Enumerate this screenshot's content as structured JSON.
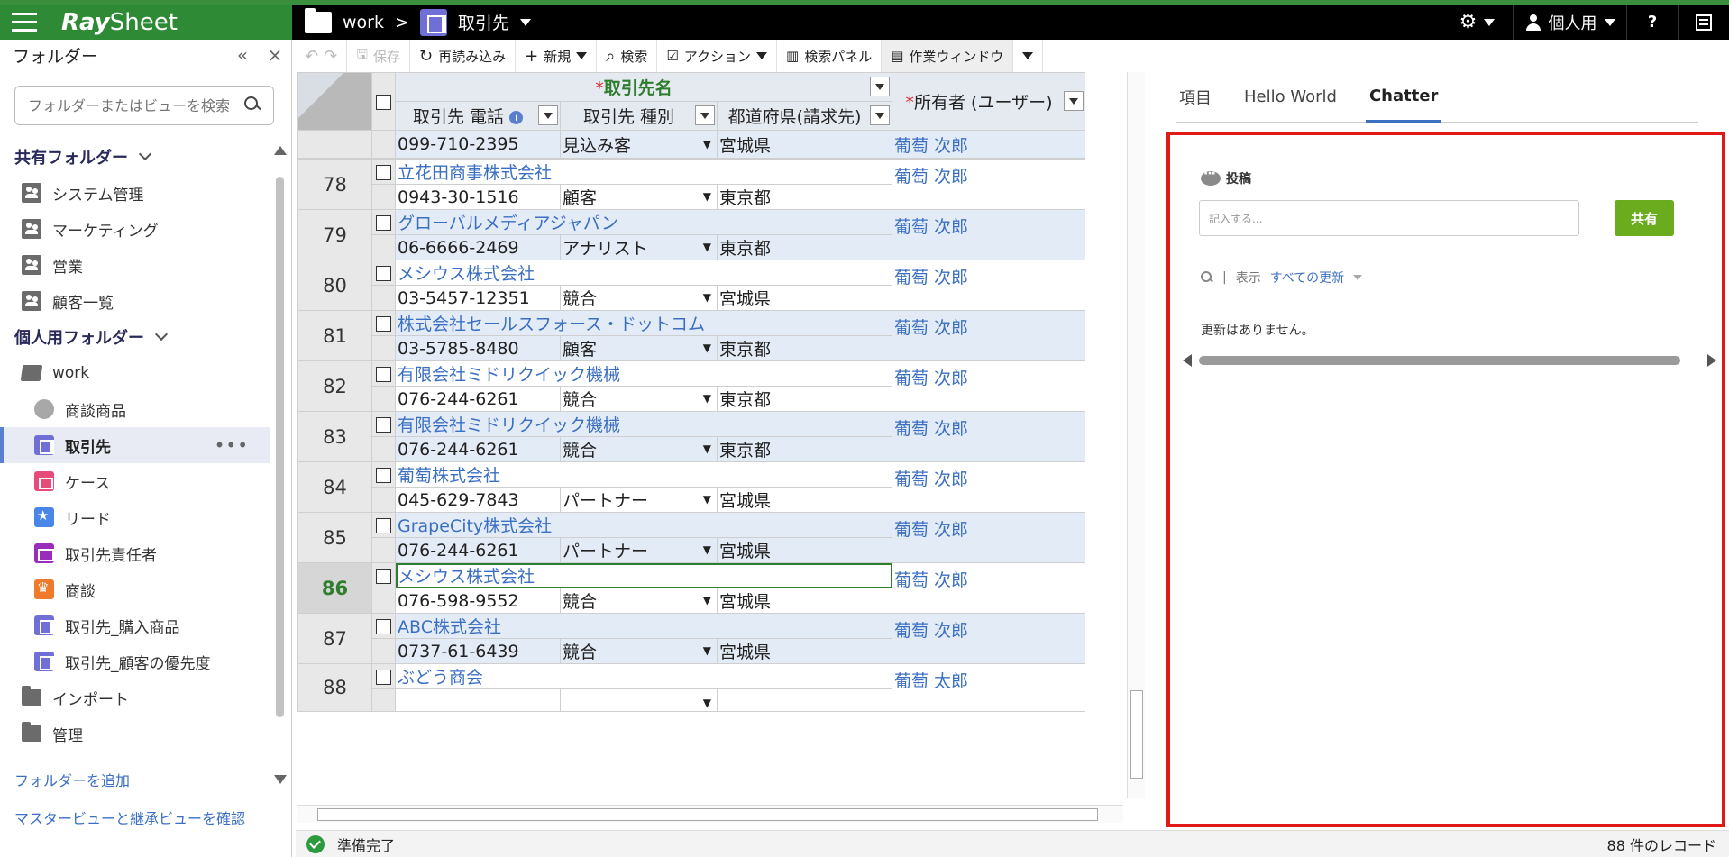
{
  "app": {
    "logo_bold": "Ray",
    "logo_rest": "Sheet"
  },
  "header": {
    "folder": "work",
    "separator": ">",
    "view": "取引先",
    "settings_label": "",
    "user_label": "個人用",
    "help_label": "?"
  },
  "sidebar": {
    "title": "フォルダー",
    "collapse": "«",
    "close": "×",
    "search_placeholder": "フォルダーまたはビューを検索",
    "shared_title": "共有フォルダー",
    "shared_items": [
      "システム管理",
      "マーケティング",
      "営業",
      "顧客一覧"
    ],
    "personal_title": "個人用フォルダー",
    "work_folder": "work",
    "work_items": [
      "商談商品",
      "取引先",
      "ケース",
      "リード",
      "取引先責任者",
      "商談",
      "取引先_購入商品",
      "取引先_顧客の優先度"
    ],
    "other_folders": [
      "インポート",
      "管理"
    ],
    "more": "•••",
    "add_folder": "フォルダーを追加",
    "check_views": "マスタービューと継承ビューを確認"
  },
  "toolbar": {
    "undo": "↶",
    "redo": "↷",
    "save": "保存",
    "reload": "再読み込み",
    "new": "新規",
    "search": "検索",
    "action": "アクション",
    "search_panel": "検索パネル",
    "work_window": "作業ウィンドウ"
  },
  "grid": {
    "required_mark": "*",
    "header_account_name": "取引先名",
    "header_phone": "取引先 電話",
    "header_type": "取引先 種別",
    "header_pref": "都道府県(請求先)",
    "header_owner": "所有者 (ユーザー)",
    "info_glyph": "i",
    "partial_row": {
      "phone": "099-710-2395",
      "type": "見込み客",
      "pref": "宮城県",
      "owner": "葡萄 次郎"
    },
    "rows": [
      {
        "num": "78",
        "name": "立花田商事株式会社",
        "phone": "0943-30-1516",
        "type": "顧客",
        "pref": "東京都",
        "owner": "葡萄 次郎"
      },
      {
        "num": "79",
        "name": "グローバルメディアジャパン",
        "phone": "06-6666-2469",
        "type": "アナリスト",
        "pref": "東京都",
        "owner": "葡萄 次郎"
      },
      {
        "num": "80",
        "name": "メシウス株式会社",
        "phone": "03-5457-12351",
        "type": "競合",
        "pref": "宮城県",
        "owner": "葡萄 次郎"
      },
      {
        "num": "81",
        "name": "株式会社セールスフォース・ドットコム",
        "phone": "03-5785-8480",
        "type": "顧客",
        "pref": "東京都",
        "owner": "葡萄 次郎"
      },
      {
        "num": "82",
        "name": "有限会社ミドリクイック機械",
        "phone": "076-244-6261",
        "type": "競合",
        "pref": "東京都",
        "owner": "葡萄 次郎"
      },
      {
        "num": "83",
        "name": "有限会社ミドリクイック機械",
        "phone": "076-244-6261",
        "type": "競合",
        "pref": "東京都",
        "owner": "葡萄 次郎"
      },
      {
        "num": "84",
        "name": "葡萄株式会社",
        "phone": "045-629-7843",
        "type": "パートナー",
        "pref": "宮城県",
        "owner": "葡萄 次郎"
      },
      {
        "num": "85",
        "name": "GrapeCity株式会社",
        "phone": "076-244-6261",
        "type": "パートナー",
        "pref": "宮城県",
        "owner": "葡萄 次郎"
      },
      {
        "num": "86",
        "name": "メシウス株式会社",
        "phone": "076-598-9552",
        "type": "競合",
        "pref": "宮城県",
        "owner": "葡萄 次郎"
      },
      {
        "num": "87",
        "name": "ABC株式会社",
        "phone": "0737-61-6439",
        "type": "競合",
        "pref": "宮城県",
        "owner": "葡萄 次郎"
      },
      {
        "num": "88",
        "name": "ぶどう商会",
        "phone": "",
        "type": "",
        "pref": "",
        "owner": "葡萄 太郎"
      }
    ]
  },
  "status": {
    "text": "準備完了",
    "count": "88 件のレコード"
  },
  "rpanel": {
    "tabs": [
      "項目",
      "Hello World",
      "Chatter"
    ],
    "post_label": "投稿",
    "post_placeholder": "記入する...",
    "share_button": "共有",
    "filter_sep": "|",
    "filter_label": "表示",
    "filter_value": "すべての更新",
    "empty_message": "更新はありません。"
  },
  "colors": {
    "brand_green": "#2f8a35",
    "link_blue": "#3b6fc2",
    "highlight_red": "#e11818",
    "share_green": "#6bab1e"
  }
}
